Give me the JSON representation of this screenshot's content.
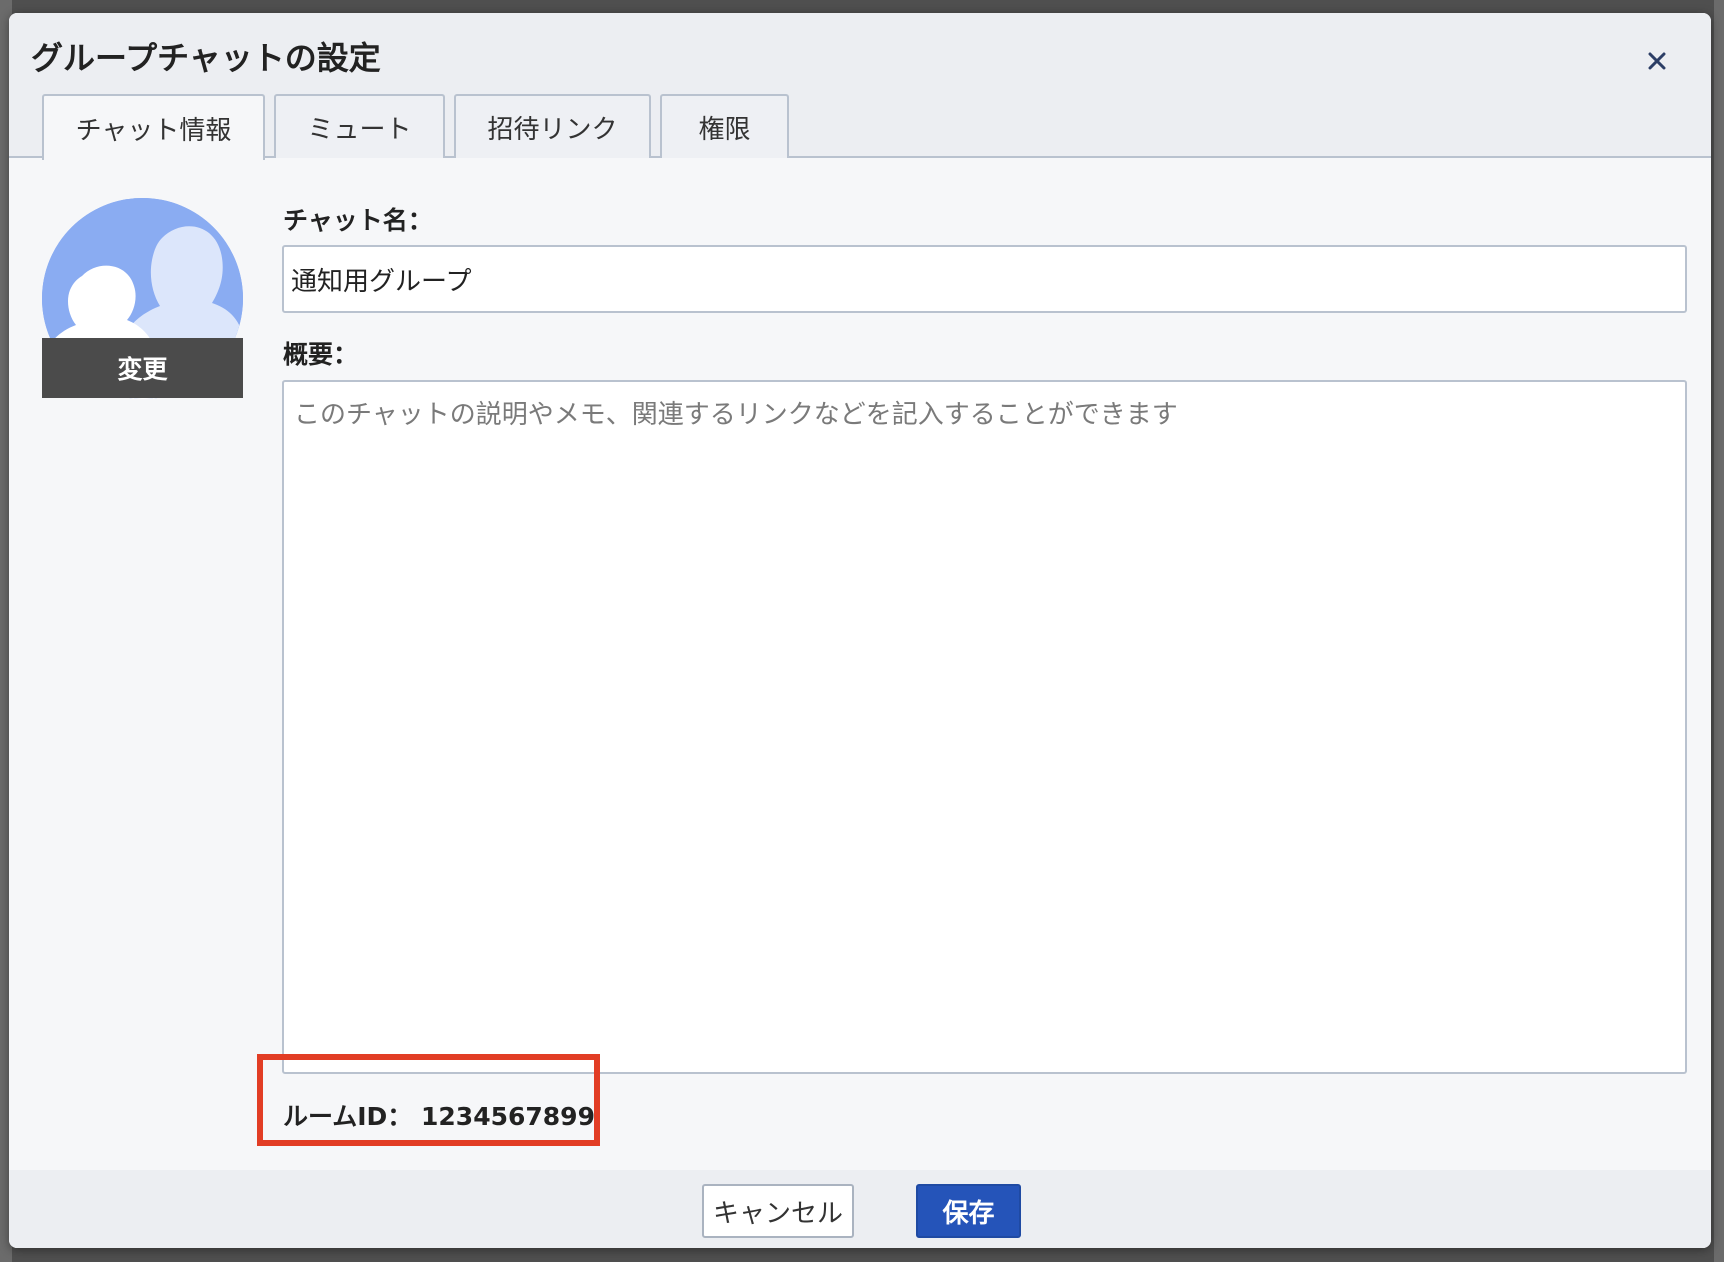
{
  "dialog": {
    "title": "グループチャットの設定"
  },
  "tabs": [
    {
      "label": "チャット情報"
    },
    {
      "label": "ミュート"
    },
    {
      "label": "招待リンク"
    },
    {
      "label": "権限"
    }
  ],
  "avatar": {
    "change_label": "変更"
  },
  "form": {
    "chat_name_label": "チャット名：",
    "chat_name_value": "通知用グループ",
    "summary_label": "概要：",
    "summary_placeholder": "このチャットの説明やメモ、関連するリンクなどを記入することができます"
  },
  "room_id": {
    "text": "ルームID： 1234567899"
  },
  "footer": {
    "cancel_label": "キャンセル",
    "save_label": "保存"
  },
  "colors": {
    "accent": "#2554b9",
    "highlight": "#e23d25",
    "avatar_bg": "#8aacf2"
  }
}
